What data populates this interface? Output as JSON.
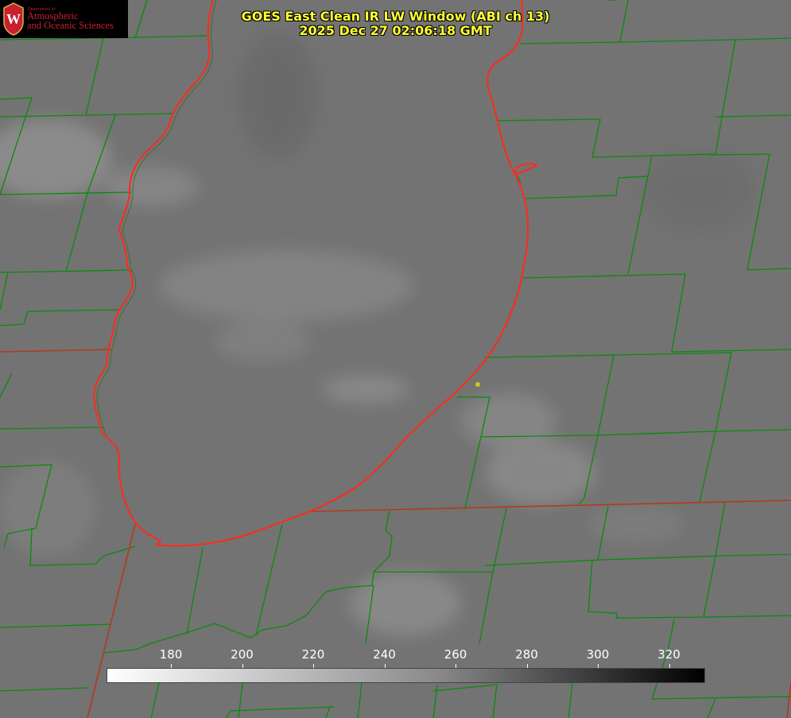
{
  "title": {
    "line1": "GOES East Clean IR LW Window (ABI ch 13)",
    "line2": "2025 Dec 27 02:06:18 GMT"
  },
  "logo": {
    "line1": "Department of",
    "line2": "Atmospheric",
    "line3": "and Oceanic Sciences",
    "seal_letter": "W"
  },
  "colorbar": {
    "ticks": [
      "180",
      "200",
      "220",
      "240",
      "260",
      "280",
      "300",
      "320"
    ],
    "gradient_from": "#ffffff",
    "gradient_to": "#000000"
  },
  "colors": {
    "background_gray": "#737373",
    "county_lines": "#0b8a0b",
    "coastline": "#ff2a1a",
    "title_text": "#ffff33",
    "marker": "#d4c21c",
    "logo_red": "#c8202f"
  }
}
